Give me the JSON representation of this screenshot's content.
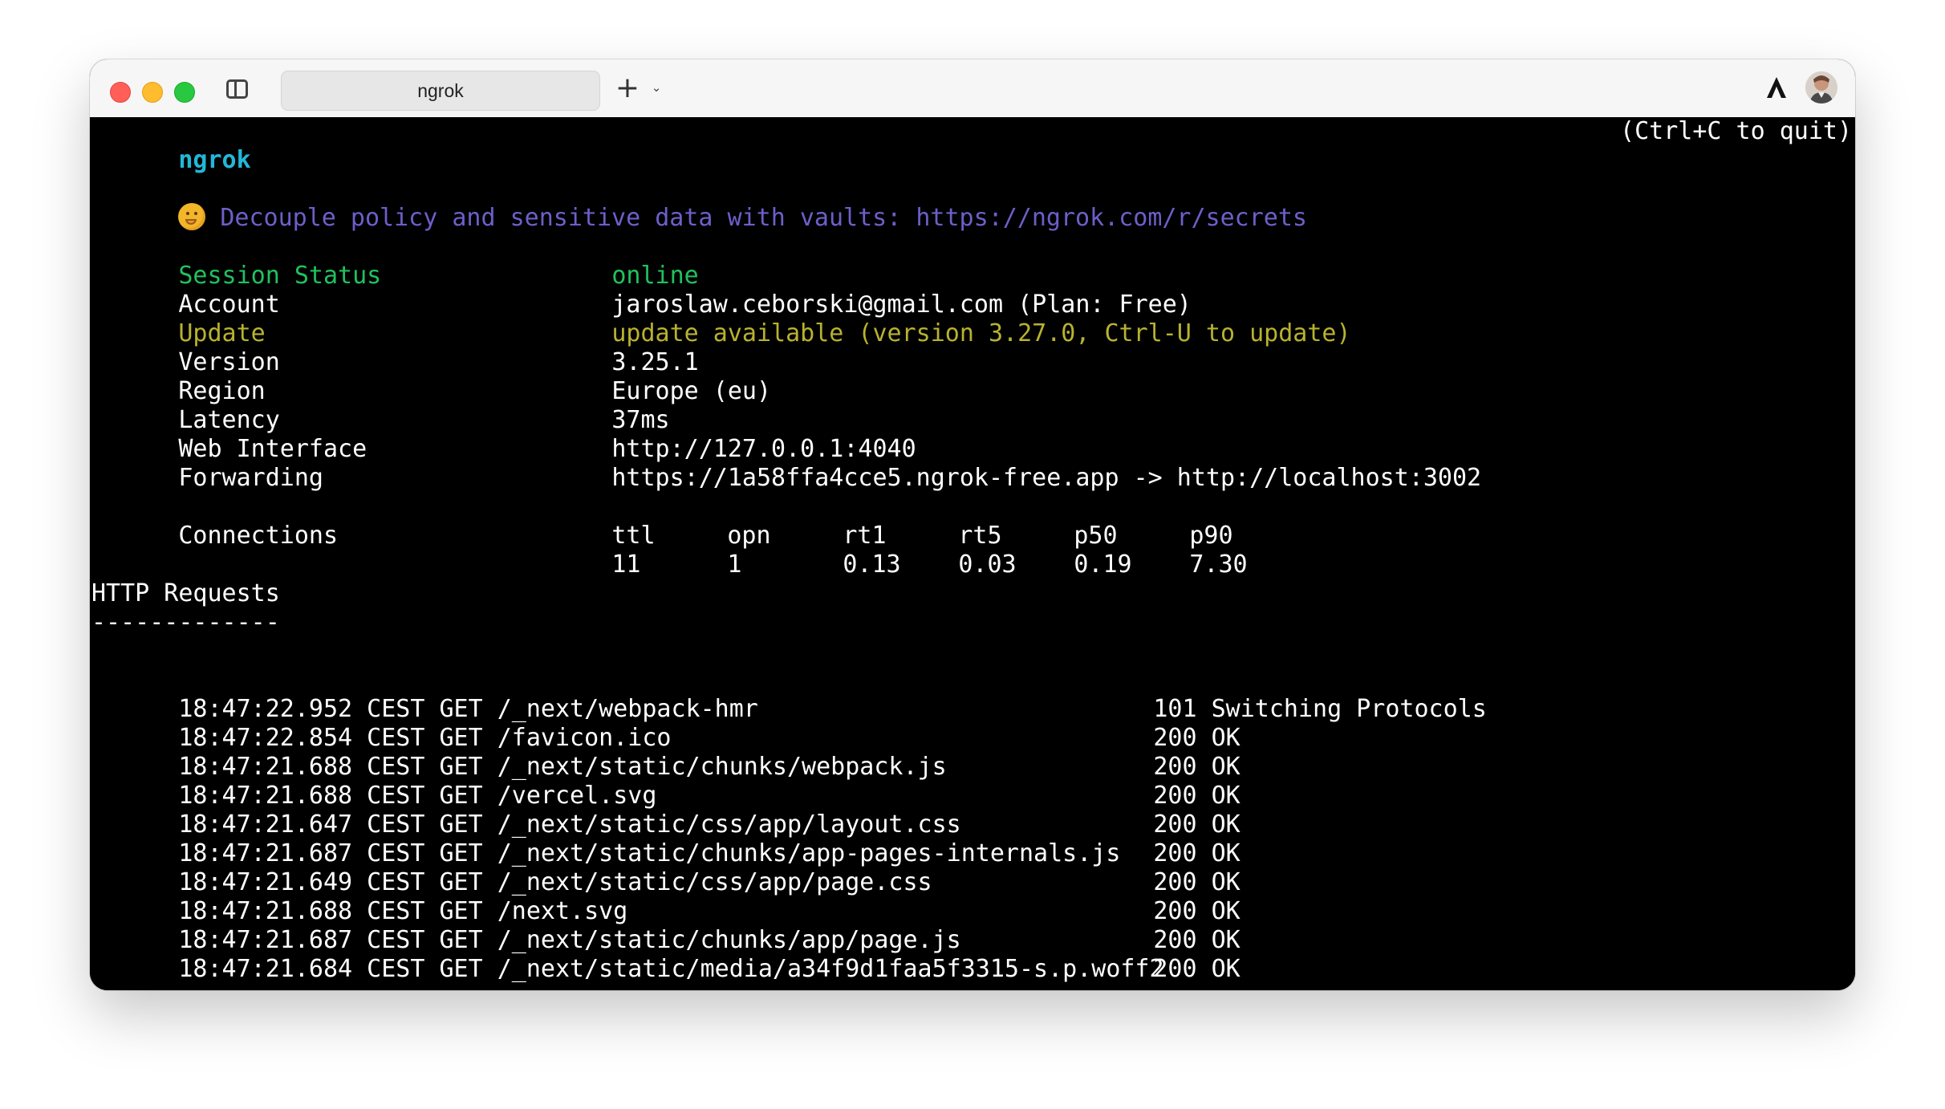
{
  "window": {
    "tab_title": "ngrok",
    "new_tab_symbol": "+",
    "tab_menu_symbol": "⌄"
  },
  "terminal": {
    "app_name": "ngrok",
    "quit_hint": "(Ctrl+C to quit)",
    "promo": "Decouple policy and sensitive data with vaults: https://ngrok.com/r/secrets",
    "status_rows": [
      {
        "label": "Session Status",
        "value": "online"
      },
      {
        "label": "Account",
        "value": "jaroslaw.ceborski@gmail.com (Plan: Free)"
      },
      {
        "label": "Update",
        "value": "update available (version 3.27.0, Ctrl-U to update)"
      },
      {
        "label": "Version",
        "value": "3.25.1"
      },
      {
        "label": "Region",
        "value": "Europe (eu)"
      },
      {
        "label": "Latency",
        "value": "37ms"
      },
      {
        "label": "Web Interface",
        "value": "http://127.0.0.1:4040"
      },
      {
        "label": "Forwarding",
        "value": "https://1a58ffa4cce5.ngrok-free.app -> http://localhost:3002"
      }
    ],
    "connections": {
      "label": "Connections",
      "headers": [
        "ttl",
        "opn",
        "rt1",
        "rt5",
        "p50",
        "p90"
      ],
      "values": [
        "11",
        "1",
        "0.13",
        "0.03",
        "0.19",
        "7.30"
      ]
    },
    "http_requests": {
      "heading": "HTTP Requests",
      "underline": "-------------",
      "rows": [
        {
          "line": "18:47:22.952 CEST GET /_next/webpack-hmr",
          "status": "101 Switching Protocols"
        },
        {
          "line": "18:47:22.854 CEST GET /favicon.ico",
          "status": "200 OK"
        },
        {
          "line": "18:47:21.688 CEST GET /_next/static/chunks/webpack.js",
          "status": "200 OK"
        },
        {
          "line": "18:47:21.688 CEST GET /vercel.svg",
          "status": "200 OK"
        },
        {
          "line": "18:47:21.647 CEST GET /_next/static/css/app/layout.css",
          "status": "200 OK"
        },
        {
          "line": "18:47:21.687 CEST GET /_next/static/chunks/app-pages-internals.js",
          "status": "200 OK"
        },
        {
          "line": "18:47:21.649 CEST GET /_next/static/css/app/page.css",
          "status": "200 OK"
        },
        {
          "line": "18:47:21.688 CEST GET /next.svg",
          "status": "200 OK"
        },
        {
          "line": "18:47:21.687 CEST GET /_next/static/chunks/app/page.js",
          "status": "200 OK"
        },
        {
          "line": "18:47:21.684 CEST GET /_next/static/media/a34f9d1faa5f3315-s.p.woff2",
          "status": "200 OK"
        }
      ]
    }
  },
  "icons": {
    "traffic_lights": [
      "close",
      "minimize",
      "maximize"
    ],
    "sidebar": "sidebar-toggle-icon",
    "ai": "ai-assistant-icon",
    "avatar": "user-avatar",
    "emoji": "thinking-face"
  },
  "colors": {
    "terminal_bg": "#000000",
    "terminal_text": "#ffffff",
    "ngrok_cyan": "#21b8d8",
    "promo_purple": "#6d5fc9",
    "online_green": "#20c15e",
    "update_yellow": "#b8b230"
  }
}
